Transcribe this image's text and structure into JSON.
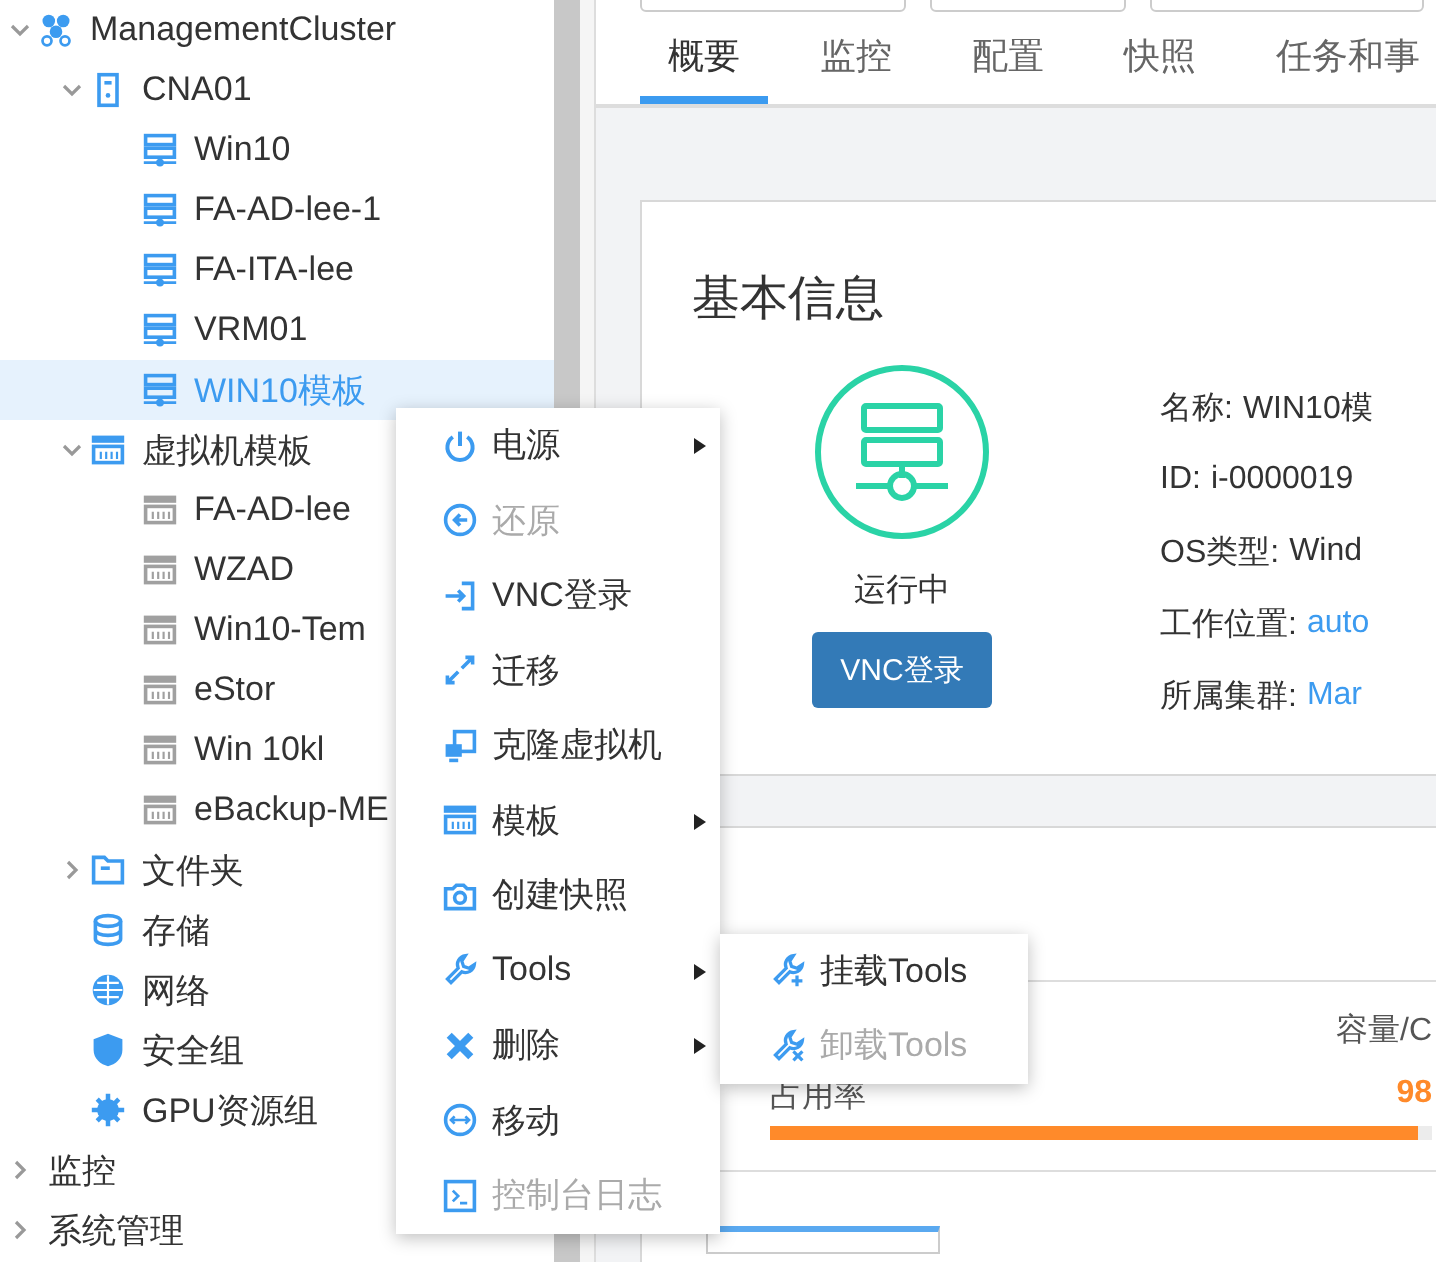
{
  "tree": [
    {
      "label": "ManagementCluster",
      "kind": "cluster",
      "expanded": true,
      "selected": false,
      "children": [
        {
          "label": "CNA01",
          "kind": "host",
          "expanded": true,
          "selected": false,
          "children": [
            {
              "label": "Win10",
              "kind": "vm",
              "selected": false
            },
            {
              "label": "FA-AD-lee-1",
              "kind": "vm",
              "selected": false
            },
            {
              "label": "FA-ITA-lee",
              "kind": "vm",
              "selected": false
            },
            {
              "label": "VRM01",
              "kind": "vm",
              "selected": false
            },
            {
              "label": "WIN10模板",
              "kind": "vm",
              "selected": true
            }
          ]
        },
        {
          "label": "虚拟机模板",
          "kind": "template-folder",
          "expanded": true,
          "selected": false,
          "children": [
            {
              "label": "FA-AD-lee",
              "kind": "template",
              "selected": false
            },
            {
              "label": "WZAD",
              "kind": "template",
              "selected": false
            },
            {
              "label": "Win10-Tem",
              "kind": "template",
              "selected": false
            },
            {
              "label": "eStor",
              "kind": "template",
              "selected": false
            },
            {
              "label": "Win 10kl",
              "kind": "template",
              "selected": false
            },
            {
              "label": "eBackup-ME",
              "kind": "template",
              "selected": false
            }
          ]
        },
        {
          "label": "文件夹",
          "kind": "folder",
          "expanded": false,
          "selected": false
        },
        {
          "label": "存储",
          "kind": "storage",
          "selected": false
        },
        {
          "label": "网络",
          "kind": "network",
          "selected": false
        },
        {
          "label": "安全组",
          "kind": "security",
          "selected": false
        },
        {
          "label": "GPU资源组",
          "kind": "gpu",
          "selected": false
        }
      ]
    },
    {
      "label": "监控",
      "kind": "none",
      "expanded": false,
      "selected": false
    },
    {
      "label": "系统管理",
      "kind": "none",
      "expanded": false,
      "selected": false
    }
  ],
  "tabs": [
    {
      "label": "概要",
      "selected": true
    },
    {
      "label": "监控",
      "selected": false
    },
    {
      "label": "配置",
      "selected": false
    },
    {
      "label": "快照",
      "selected": false
    },
    {
      "label": "任务和事",
      "selected": false
    }
  ],
  "basic_info": {
    "title": "基本信息",
    "status": "运行中",
    "vnc_button": "VNC登录",
    "fields": [
      {
        "label": "名称:",
        "value": "WIN10模",
        "link": false
      },
      {
        "label": "ID:",
        "value": "i-0000019",
        "link": false
      },
      {
        "label": "OS类型:",
        "value": "Wind",
        "link": false
      },
      {
        "label": "工作位置:",
        "value": "auto",
        "link": true
      },
      {
        "label": "所属集群:",
        "value": "Mar",
        "link": true
      }
    ]
  },
  "hardware": {
    "capacity_label": "容量/C",
    "usage_label": "占用率",
    "usage_value": "98",
    "level": 0.98
  },
  "context_menu": {
    "items": [
      {
        "label": "电源",
        "kind": "power",
        "disabled": false,
        "has_submenu": true
      },
      {
        "label": "还原",
        "kind": "restore",
        "disabled": true,
        "has_submenu": false
      },
      {
        "label": "VNC登录",
        "kind": "login",
        "disabled": false,
        "has_submenu": false
      },
      {
        "label": "迁移",
        "kind": "migrate",
        "disabled": false,
        "has_submenu": false
      },
      {
        "label": "克隆虚拟机",
        "kind": "clone",
        "disabled": false,
        "has_submenu": false
      },
      {
        "label": "模板",
        "kind": "template-blue",
        "disabled": false,
        "has_submenu": true
      },
      {
        "label": "创建快照",
        "kind": "snapshot",
        "disabled": false,
        "has_submenu": false
      },
      {
        "label": "Tools",
        "kind": "wrench",
        "disabled": false,
        "has_submenu": true,
        "submenu": [
          {
            "label": "挂载Tools",
            "kind": "wrench-plus",
            "disabled": false
          },
          {
            "label": "卸载Tools",
            "kind": "wrench-x",
            "disabled": true
          }
        ]
      },
      {
        "label": "删除",
        "kind": "cross",
        "disabled": false,
        "has_submenu": true
      },
      {
        "label": "移动",
        "kind": "move",
        "disabled": false,
        "has_submenu": false
      },
      {
        "label": "控制台日志",
        "kind": "terminal",
        "disabled": true,
        "has_submenu": false
      }
    ]
  }
}
